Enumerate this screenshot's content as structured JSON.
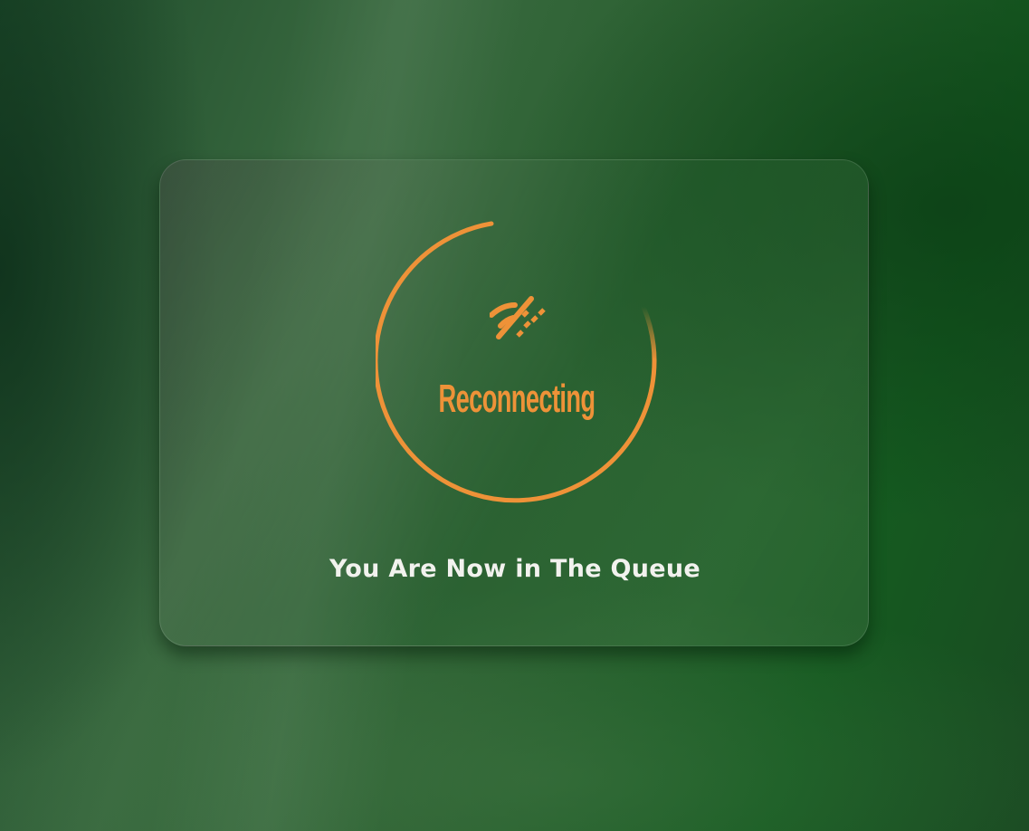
{
  "screen": {
    "status_label": "Reconnecting",
    "message": "You Are Now in The Queue",
    "status_icon": "wifi-off-icon"
  },
  "colors": {
    "accent": "#ee9238",
    "message_text": "#f2f2ee",
    "background": "#2a6030"
  }
}
